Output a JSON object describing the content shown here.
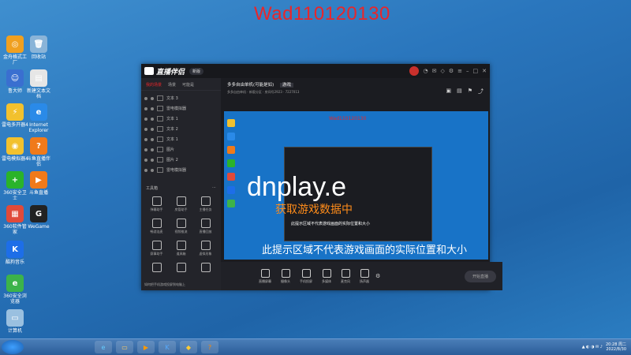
{
  "watermark": "Wad110120130",
  "desktop_icons": [
    {
      "label": "金舟格式工厂",
      "color": "#f0a020",
      "glyph": "◎"
    },
    {
      "label": "回收站",
      "color": "#8ab4d8",
      "glyph": "🗑"
    },
    {
      "label": "鲁大师",
      "color": "#3a6fd0",
      "glyph": "☺"
    },
    {
      "label": "新建文本文档",
      "color": "#e6e6e6",
      "glyph": "▤"
    },
    {
      "label": "雷电多开器4",
      "color": "#f2c12e",
      "glyph": "⚡"
    },
    {
      "label": "Internet Explorer",
      "color": "#2a8ae8",
      "glyph": "e"
    },
    {
      "label": "雷电模拟器4",
      "color": "#f2c12e",
      "glyph": "◉"
    },
    {
      "label": "斗鱼直播伴侣",
      "color": "#f07a1a",
      "glyph": "?"
    },
    {
      "label": "360安全卫士",
      "color": "#2ab32a",
      "glyph": "+"
    },
    {
      "label": "斗鱼直播",
      "color": "#f07a1a",
      "glyph": "▶"
    },
    {
      "label": "360软件管家",
      "color": "#e04a3a",
      "glyph": "▦"
    },
    {
      "label": "WeGame",
      "color": "#222222",
      "glyph": "G"
    },
    {
      "label": "酷狗音乐",
      "color": "#1d6ee8",
      "glyph": "K"
    },
    {
      "label": "360安全浏览器",
      "color": "#3cb34a",
      "glyph": "e"
    },
    {
      "label": "计算机",
      "color": "#9ac0e0",
      "glyph": "▭"
    }
  ],
  "window": {
    "app_name": "直播伴侣",
    "version": "新版",
    "left_tabs": [
      "我的场景",
      "场景",
      "可能是"
    ],
    "scenes": [
      "文本 3",
      "雷电模拟器",
      "文本 1",
      "文本 2",
      "文本 1",
      "图片",
      "图片 2",
      "雷电模拟器"
    ],
    "tools_label": "工具箱",
    "tools": [
      "弹幕助手",
      "房管助手",
      "主播任务",
      "畅游连麦",
      "视频推流",
      "直播回放",
      "赛事助手",
      "道具箱",
      "虚拟形象",
      "",
      "",
      ""
    ],
    "left_footer": "如何把手机游戏投屏到电脑上",
    "room_title": "多多自由单机(可能是如)",
    "room_tag": "游戏",
    "room_sub": "多多自由单机 · 新版分区 · 房间号2923 · 7227013",
    "preview_red": "Wad110120130",
    "big_text": "dnplay.e",
    "orange_text": "获取游戏数据中",
    "hint_small": "此提示区域不代表游戏画面的实际位置和大小",
    "hint_big": "此提示区域不代表游戏画面的实际位置和大小",
    "bottom_items": [
      "直播屏幕",
      "摄像头",
      "手机投屏",
      "多媒体",
      "麦克风",
      "扬声器"
    ],
    "go_live": "开始直播"
  },
  "taskbar": {
    "time": "20:28 周二",
    "date": "2022/8/30"
  }
}
